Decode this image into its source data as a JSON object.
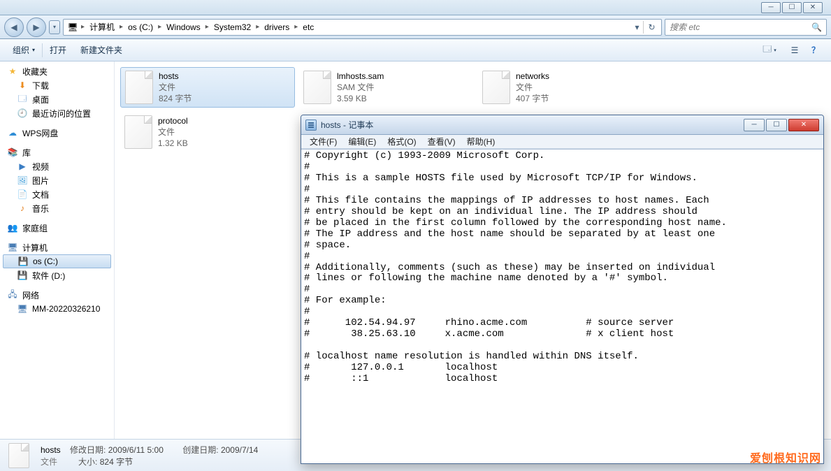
{
  "titlebar": {
    "min_symbol": "─",
    "max_symbol": "☐",
    "close_symbol": "✕"
  },
  "nav": {
    "back_symbol": "◀",
    "fwd_symbol": "▶",
    "history_symbol": "▾",
    "pc_icon": "🖥",
    "sep": "▸",
    "refresh_down": "▾",
    "refresh_icon": "↻",
    "crumbs": [
      "计算机",
      "os (C:)",
      "Windows",
      "System32",
      "drivers",
      "etc"
    ],
    "search_placeholder": "搜索 etc",
    "search_icon": "🔍"
  },
  "toolbar": {
    "organize": "组织",
    "open": "打开",
    "newfolder": "新建文件夹",
    "drop": "▾",
    "view_icon": "🗔",
    "preview_icon": "☰",
    "help_icon": "？"
  },
  "sidebar": {
    "fav": {
      "label": "收藏夹",
      "items": [
        {
          "icon": "⬇",
          "label": "下载",
          "cls": "folder-blue"
        },
        {
          "icon": "🗔",
          "label": "桌面",
          "cls": "play"
        },
        {
          "icon": "🕘",
          "label": "最近访问的位置",
          "cls": "folder-blue"
        }
      ]
    },
    "wps": {
      "icon": "☁",
      "label": "WPS网盘",
      "cls": "wps"
    },
    "lib": {
      "label": "库",
      "items": [
        {
          "icon": "▶",
          "label": "视频",
          "cls": "play"
        },
        {
          "icon": "🖼",
          "label": "图片",
          "cls": "pic"
        },
        {
          "icon": "📄",
          "label": "文档",
          "cls": "doc"
        },
        {
          "icon": "♪",
          "label": "音乐",
          "cls": "music"
        }
      ]
    },
    "home": {
      "icon": "👥",
      "label": "家庭组",
      "cls": "home"
    },
    "pc": {
      "label": "计算机",
      "items": [
        {
          "icon": "💾",
          "label": "os (C:)",
          "cls": "drive-c",
          "selected": true
        },
        {
          "icon": "💾",
          "label": "软件 (D:)",
          "cls": "drive-d"
        }
      ]
    },
    "net": {
      "label": "网络",
      "items": [
        {
          "icon": "🖥",
          "label": "MM-20220326210",
          "cls": "net"
        }
      ]
    }
  },
  "files": [
    {
      "name": "hosts",
      "type": "文件",
      "size": "824 字节",
      "selected": true
    },
    {
      "name": "lmhosts.sam",
      "type": "SAM 文件",
      "size": "3.59 KB"
    },
    {
      "name": "networks",
      "type": "文件",
      "size": "407 字节"
    },
    {
      "name": "protocol",
      "type": "文件",
      "size": "1.32 KB"
    }
  ],
  "details": {
    "name": "hosts",
    "type": "文件",
    "mod_label": "修改日期:",
    "mod_val": "2009/6/11 5:00",
    "size_label": "大小:",
    "size_val": "824 字节",
    "created_label": "创建日期:",
    "created_val": "2009/7/14"
  },
  "notepad": {
    "title": "hosts - 记事本",
    "menu": [
      "文件(F)",
      "编辑(E)",
      "格式(O)",
      "查看(V)",
      "帮助(H)"
    ],
    "min": "─",
    "max": "☐",
    "close": "✕",
    "content": "# Copyright (c) 1993-2009 Microsoft Corp.\n#\n# This is a sample HOSTS file used by Microsoft TCP/IP for Windows.\n#\n# This file contains the mappings of IP addresses to host names. Each\n# entry should be kept on an individual line. The IP address should\n# be placed in the first column followed by the corresponding host name.\n# The IP address and the host name should be separated by at least one\n# space.\n#\n# Additionally, comments (such as these) may be inserted on individual\n# lines or following the machine name denoted by a '#' symbol.\n#\n# For example:\n#\n#      102.54.94.97     rhino.acme.com          # source server\n#       38.25.63.10     x.acme.com              # x client host\n\n# localhost name resolution is handled within DNS itself.\n#\t127.0.0.1       localhost\n#\t::1             localhost"
  },
  "watermark": "爱刨根知识网"
}
